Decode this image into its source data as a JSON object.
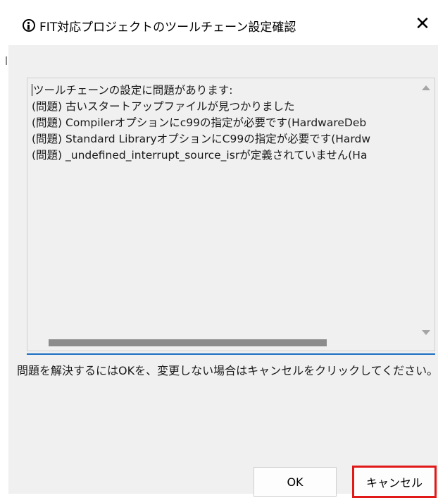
{
  "window": {
    "title": "FIT対応プロジェクトのツールチェーン設定確認",
    "close_label": "✕"
  },
  "details": {
    "lines": [
      "ツールチェーンの設定に問題があります:",
      "(問題) 古いスタートアップファイルが見つかりました",
      "(問題) Compilerオプションにc99の指定が必要です(HardwareDeb",
      "(問題) Standard LibraryオプションにC99の指定が必要です(Hardw",
      "(問題) _undefined_interrupt_source_isrが定義されていません(Ha"
    ]
  },
  "instruction": "問題を解決するにはOKを、変更しない場合はキャンセルをクリックしてください。",
  "buttons": {
    "ok_label": "OK",
    "cancel_label": "キャンセル"
  },
  "colors": {
    "highlight": "#e01818",
    "focus_underline": "#1b6ec2"
  },
  "icons": {
    "title": "info-icon",
    "close": "close-icon",
    "scroll_up": "chevron-up-icon",
    "scroll_down": "chevron-down-icon"
  }
}
